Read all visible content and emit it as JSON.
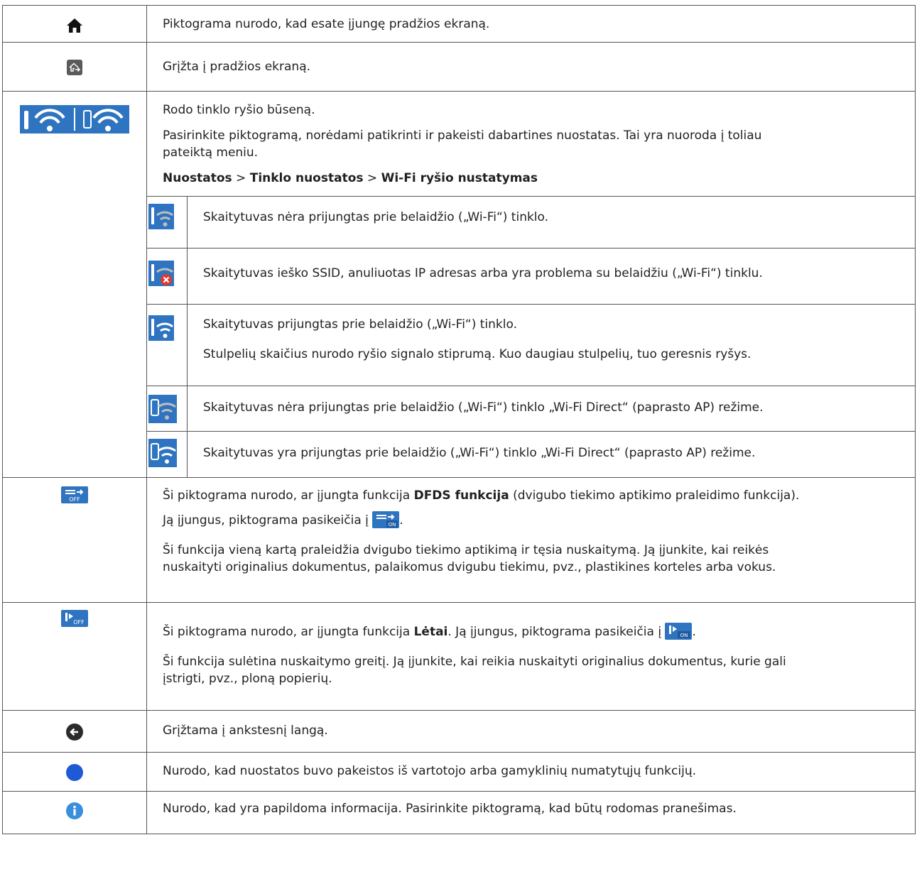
{
  "rows": {
    "home": {
      "text": "Piktograma nurodo, kad esate įjungę pradžios ekraną."
    },
    "return_home": {
      "text": "Grįžta į pradžios ekraną."
    },
    "network": {
      "line1": "Rodo tinklo ryšio būseną.",
      "line2": "Pasirinkite piktogramą, norėdami patikrinti ir pakeisti dabartines nuostatas. Tai yra nuoroda į toliau",
      "line3": "pateiktą meniu.",
      "menu_a": "Nuostatos",
      "menu_sep1": " > ",
      "menu_b": "Tinklo nuostatos",
      "menu_sep2": " > ",
      "menu_c": "Wi-Fi ryšio nustatymas",
      "sub": [
        {
          "icon": "wifi-disconnected-icon",
          "text": "Skaitytuvas nėra prijungtas prie belaidžio („Wi-Fi“) tinklo."
        },
        {
          "icon": "wifi-error-icon",
          "text": "Skaitytuvas ieško SSID, anuliuotas IP adresas arba yra problema su belaidžiu („Wi-Fi“) tinklu."
        },
        {
          "icon": "wifi-connected-icon",
          "text": "Skaitytuvas prijungtas prie belaidžio („Wi-Fi“) tinklo.",
          "text2": "Stulpelių skaičius nurodo ryšio signalo stiprumą. Kuo daugiau stulpelių, tuo geresnis ryšys."
        },
        {
          "icon": "wifi-direct-disconnected-icon",
          "text": "Skaitytuvas nėra prijungtas prie belaidžio („Wi-Fi“) tinklo „Wi-Fi Direct“ (paprasto AP) režime."
        },
        {
          "icon": "wifi-direct-connected-icon",
          "text": "Skaitytuvas yra prijungtas prie belaidžio („Wi-Fi“) tinklo „Wi-Fi Direct“ (paprasto AP) režime."
        }
      ]
    },
    "dfds": {
      "pre": "Ši piktograma nurodo, ar įjungta funkcija ",
      "bold": "DFDS funkcija",
      "post": " (dvigubo tiekimo aptikimo praleidimo funkcija).",
      "line2_pre": "Ją įjungus, piktograma pasikeičia į ",
      "line2_post": ".",
      "line3": "Ši funkcija vieną kartą praleidžia dvigubo tiekimo aptikimą ir tęsia nuskaitymą. Ją įjunkite, kai reikės",
      "line4": "nuskaityti originalius dokumentus, palaikomus dvigubu tiekimu, pvz., plastikines korteles arba vokus.",
      "icon_off_label": "OFF",
      "icon_on_label": "ON"
    },
    "slow": {
      "pre": "Ši piktograma nurodo, ar įjungta funkcija ",
      "bold": "Lėtai",
      "post": ". Ją įjungus, piktograma pasikeičia į ",
      "post2": ".",
      "line2": "Ši funkcija sulėtina nuskaitymo greitį. Ją įjunkite, kai reikia nuskaityti originalius dokumentus, kurie gali",
      "line3": "įstrigti, pvz., ploną popierių.",
      "icon_off_label": "OFF",
      "icon_on_label": "ON"
    },
    "back": {
      "text": "Grįžtama į ankstesnį langą."
    },
    "changed": {
      "text": "Nurodo, kad nuostatos buvo pakeistos iš vartotojo arba gamyklinių numatytųjų funkcijų."
    },
    "info": {
      "text": "Nurodo, kad yra papildoma informacija. Pasirinkite piktogramą, kad būtų rodomas pranešimas."
    }
  },
  "colors": {
    "accent": "#2f74c0",
    "text": "#231f20",
    "border": "#555555"
  }
}
